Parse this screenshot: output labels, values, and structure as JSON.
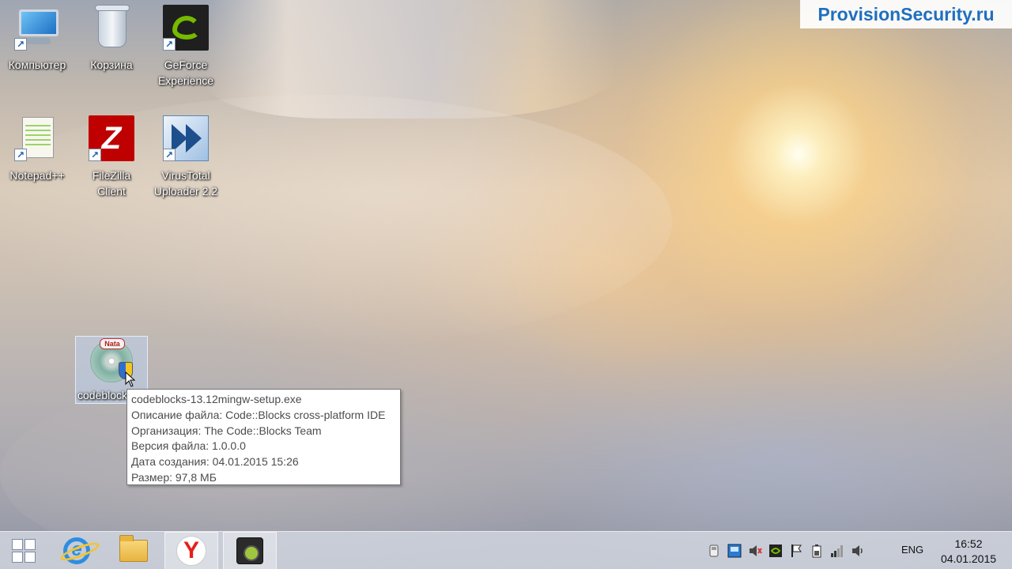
{
  "watermark": "ProvisionSecurity.ru",
  "desktop_icons": [
    {
      "label": "Компьютер",
      "icon": "computer-icon"
    },
    {
      "label": "Корзина",
      "icon": "recycle-bin-icon"
    },
    {
      "label": "GeForce\nExperience",
      "icon": "geforce-icon"
    },
    {
      "label": "Notepad++",
      "icon": "notepad-plus-plus-icon"
    },
    {
      "label": "FileZilla\nClient",
      "icon": "filezilla-icon"
    },
    {
      "label": "VirusTotal\nUploader 2.2",
      "icon": "virustotal-icon"
    }
  ],
  "selected_file": {
    "label": "codeblocks",
    "badge": "Nata",
    "icon": "installer-disc-icon"
  },
  "tooltip": {
    "filename": "codeblocks-13.12mingw-setup.exe",
    "description": "Описание файла: Code::Blocks cross-platform IDE",
    "company": "Организация: The Code::Blocks Team",
    "version": "Версия файла: 1.0.0.0",
    "created": "Дата создания: 04.01.2015 15:26",
    "size": "Размер: 97,8 МБ"
  },
  "taskbar": {
    "pinned": [
      {
        "name": "start",
        "icon": "windows-logo-icon"
      },
      {
        "name": "internet-explorer",
        "icon": "internet-explorer-icon"
      },
      {
        "name": "file-explorer",
        "icon": "folder-icon"
      },
      {
        "name": "yandex-browser",
        "icon": "yandex-icon",
        "glyph": "Y"
      },
      {
        "name": "video-recorder",
        "icon": "camera-icon"
      }
    ],
    "tray": {
      "language": "ENG",
      "time": "16:52",
      "date": "04.01.2015"
    }
  },
  "colors": {
    "watermark_text": "#1f6fbf",
    "filezilla_bg": "#bf0000",
    "nvidia_green": "#76b900",
    "yandex_red": "#e3211b"
  }
}
